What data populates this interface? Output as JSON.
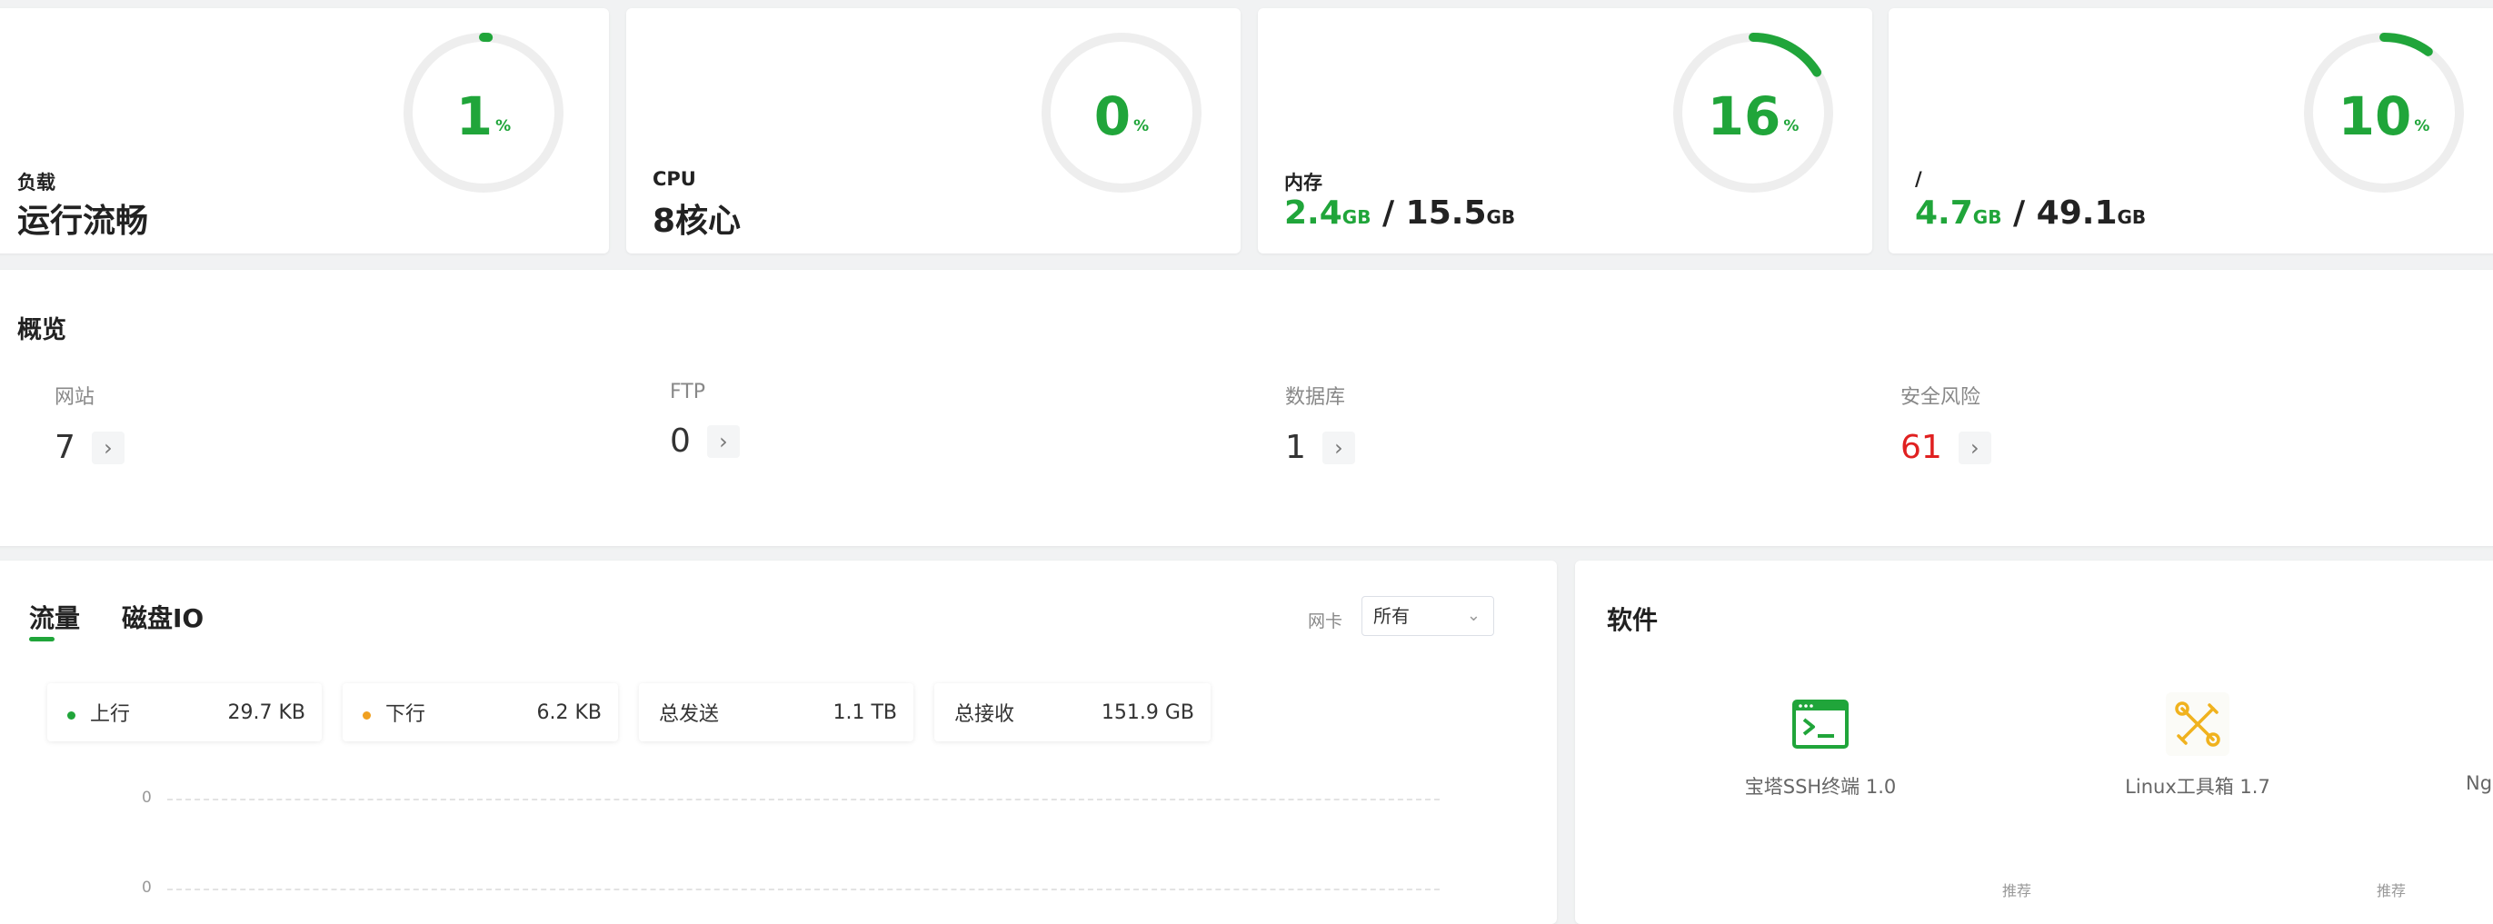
{
  "status": {
    "load": {
      "percent": "1",
      "unit": "%",
      "label": "负载",
      "value": "运行流畅",
      "fraction": 0.01
    },
    "cpu": {
      "percent": "0",
      "unit": "%",
      "label": "CPU",
      "value": "8核心",
      "fraction": 0.0
    },
    "memory": {
      "percent": "16",
      "unit": "%",
      "label": "内存",
      "used": "2.4",
      "used_unit": "GB",
      "sep": " / ",
      "total": "15.5",
      "total_unit": "GB",
      "fraction": 0.16
    },
    "disk": {
      "percent": "10",
      "unit": "%",
      "label": "/",
      "used": "4.7",
      "used_unit": "GB",
      "sep": " / ",
      "total": "49.1",
      "total_unit": "GB",
      "fraction": 0.1
    }
  },
  "overview": {
    "title": "概览",
    "items": [
      {
        "label": "网站",
        "count": "7"
      },
      {
        "label": "FTP",
        "count": "0"
      },
      {
        "label": "数据库",
        "count": "1"
      },
      {
        "label": "安全风险",
        "count": "61"
      }
    ],
    "arrow": "›"
  },
  "traffic": {
    "tabs": [
      {
        "label": "流量"
      },
      {
        "label": "磁盘IO"
      }
    ],
    "nic_label": "网卡",
    "nic_value": "所有",
    "metrics": [
      {
        "label": "上行",
        "value": "29.7 KB"
      },
      {
        "label": "下行",
        "value": "6.2 KB"
      },
      {
        "label": "总发送",
        "value": "1.1 TB"
      },
      {
        "label": "总接收",
        "value": "151.9 GB"
      }
    ],
    "ticks": [
      "0",
      "0"
    ]
  },
  "software": {
    "title": "软件",
    "items": [
      {
        "name": "宝塔SSH终端 1.0",
        "icon": "terminal-icon"
      },
      {
        "name": "Linux工具箱 1.7",
        "icon": "tools-icon"
      },
      {
        "name": "Ng",
        "icon": "nginx-icon"
      }
    ],
    "recommend": [
      "推荐",
      "推荐"
    ]
  },
  "colors": {
    "accent": "#20a53a",
    "danger": "#e02020",
    "warning": "#f0a020",
    "track": "#eeeeee"
  }
}
